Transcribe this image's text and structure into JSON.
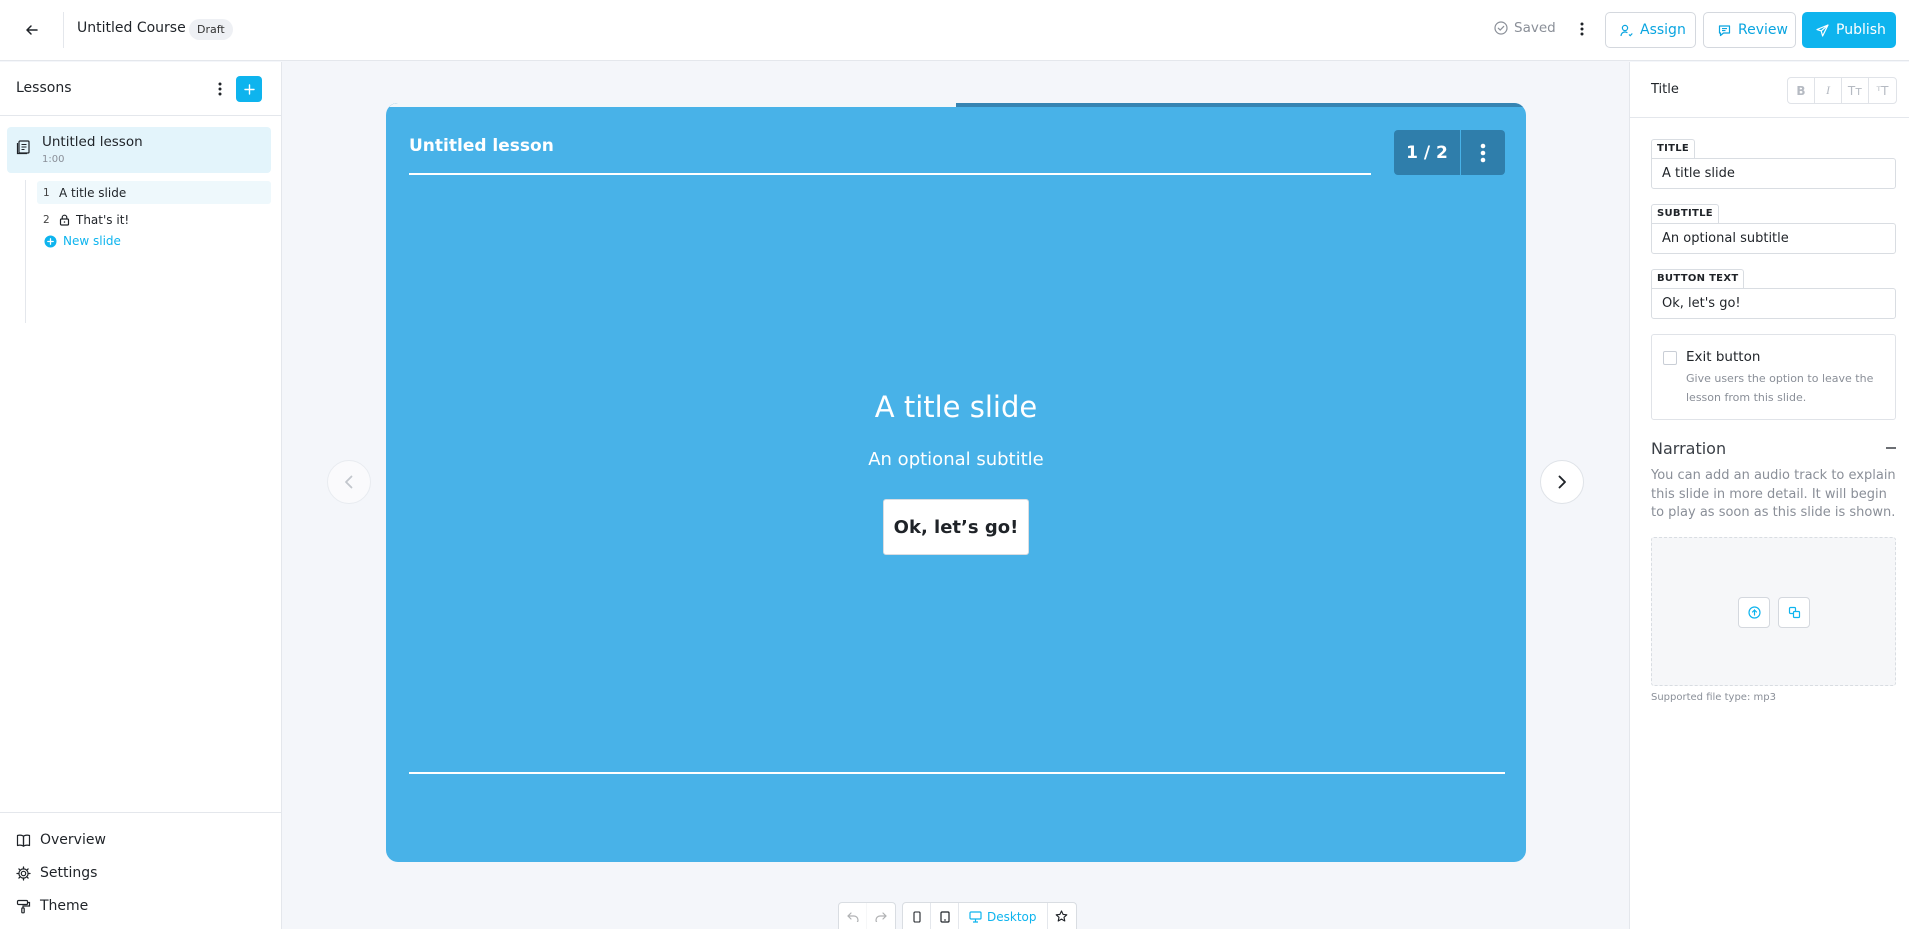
{
  "header": {
    "course_title": "Untitled Course",
    "status_badge": "Draft",
    "saved_label": "Saved",
    "assign_label": "Assign",
    "review_label": "Review",
    "publish_label": "Publish"
  },
  "sidebar": {
    "title": "Lessons",
    "lesson": {
      "name": "Untitled lesson",
      "duration": "1:00"
    },
    "slides": [
      {
        "number": "1",
        "label": "A title slide",
        "locked": false
      },
      {
        "number": "2",
        "label": "That's it!",
        "locked": true
      }
    ],
    "new_slide_label": "New slide",
    "footer_items": [
      {
        "label": "Overview",
        "icon": "book-icon"
      },
      {
        "label": "Settings",
        "icon": "gear-icon"
      },
      {
        "label": "Theme",
        "icon": "paint-roller-icon"
      }
    ]
  },
  "slide": {
    "lesson_title": "Untitled lesson",
    "counter": "1 / 2",
    "progress": 0.5,
    "title": "A title slide",
    "subtitle": "An optional subtitle",
    "button_text": "Ok, let’s go!",
    "background_color": "#48b2e8"
  },
  "toolbar": {
    "view_label": "Desktop"
  },
  "inspector": {
    "panel_title": "Title",
    "format_buttons": [
      "B",
      "I",
      "Tт",
      "ᵀT"
    ],
    "fields": [
      {
        "label": "TITLE",
        "value": "A title slide"
      },
      {
        "label": "SUBTITLE",
        "value": "An optional subtitle"
      },
      {
        "label": "BUTTON TEXT",
        "value": "Ok, let's go!"
      }
    ],
    "exit_button": {
      "label": "Exit button",
      "help": "Give users the option to leave the lesson from this slide.",
      "checked": false
    },
    "narration": {
      "title": "Narration",
      "help": "You can add an audio track to explain this slide in more detail. It will begin to play as soon as this slide is shown.",
      "supported_note": "Supported file type: mp3"
    }
  },
  "colors": {
    "accent": "#0eb4ee",
    "slide_bg": "#48b2e8",
    "counter_bg": "#2f7eab"
  }
}
